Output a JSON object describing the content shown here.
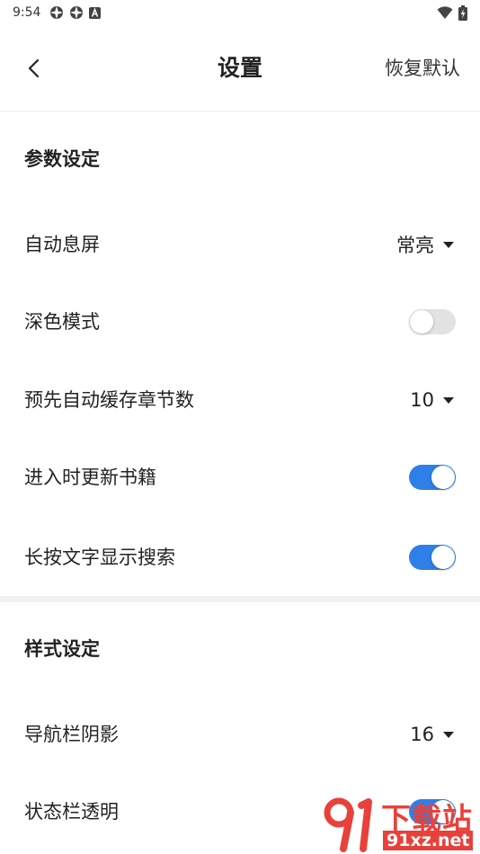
{
  "status_bar": {
    "time": "9:54",
    "left_icons": [
      "app-icon",
      "app-icon",
      "a-icon"
    ],
    "right_icons": [
      "wifi-icon",
      "battery-charging-icon"
    ]
  },
  "app_bar": {
    "title": "设置",
    "reset_label": "恢复默认"
  },
  "sections": {
    "params": {
      "title": "参数设定",
      "auto_screen_off": {
        "label": "自动息屏",
        "value": "常亮"
      },
      "dark_mode": {
        "label": "深色模式",
        "enabled": false
      },
      "precache": {
        "label": "预先自动缓存章节数",
        "value": "10"
      },
      "update_on_enter": {
        "label": "进入时更新书籍",
        "enabled": true
      },
      "longpress_search": {
        "label": "长按文字显示搜索",
        "enabled": true
      }
    },
    "style": {
      "title": "样式设定",
      "nav_shadow": {
        "label": "导航栏阴影",
        "value": "16"
      },
      "status_transparent": {
        "label": "状态栏透明",
        "enabled": true
      }
    }
  },
  "watermark": {
    "big_text": "下载站",
    "url_text": "91xz.net"
  },
  "colors": {
    "accent": "#2f7fe8",
    "toggle_off": "#e2e2e2",
    "watermark_red": "#e8413a"
  }
}
